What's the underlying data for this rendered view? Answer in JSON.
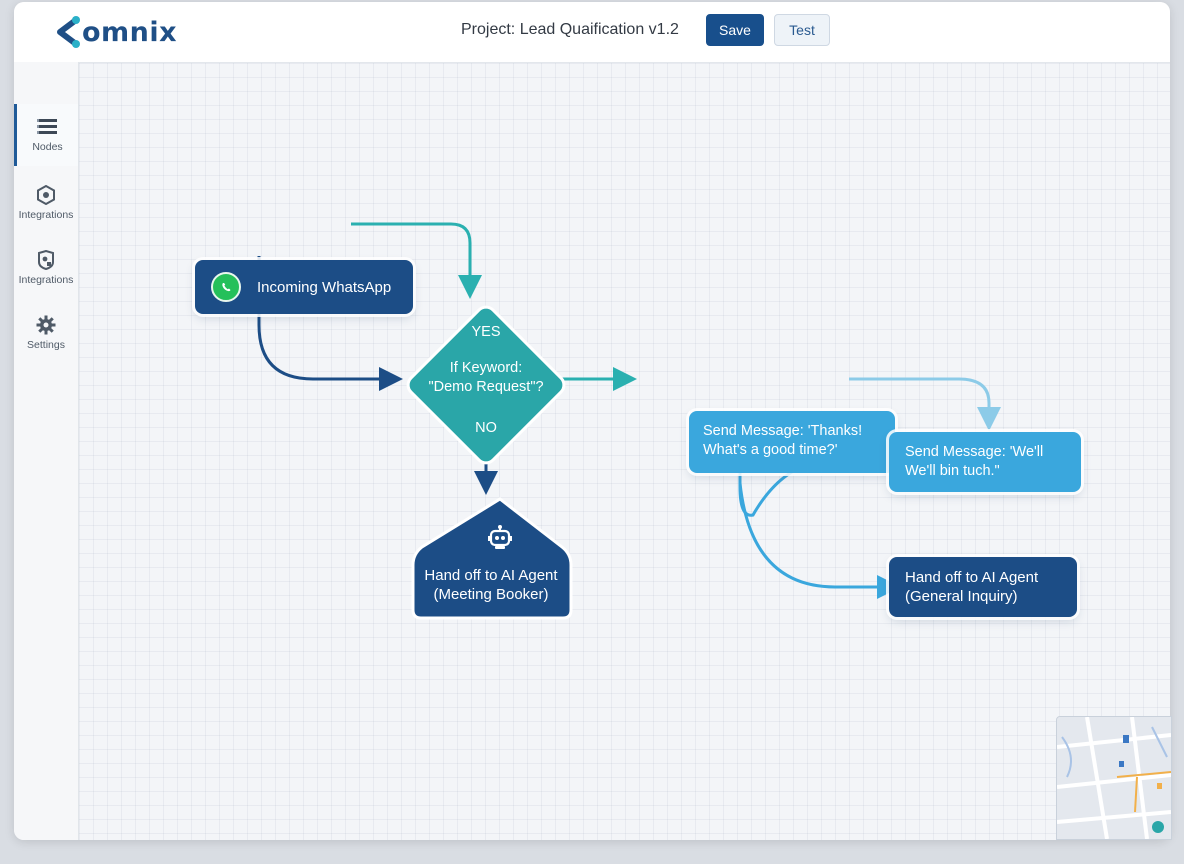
{
  "app": {
    "logo_text": "omnix",
    "project_title": "Project: Lead Quaification v1.2"
  },
  "toolbar": {
    "save_label": "Save",
    "test_label": "Test"
  },
  "sidebar": {
    "items": [
      {
        "label": "Nodes",
        "icon": "list-icon",
        "active": true
      },
      {
        "label": "Integrations",
        "icon": "hexagon-icon",
        "active": false
      },
      {
        "label": "Integrations",
        "icon": "shield-icon",
        "active": false
      },
      {
        "label": "Settings",
        "icon": "gear-icon",
        "active": false
      }
    ]
  },
  "flow": {
    "trigger": {
      "label": "Incoming WhatsApp",
      "icon": "whatsapp-icon"
    },
    "condition": {
      "yes": "YES",
      "line1": "If Keyword:",
      "line2": "\"Demo Request\"?",
      "no": "NO"
    },
    "agent_meeting": {
      "line1": "Hand off to AI Agent",
      "line2": "(Meeting Booker)",
      "icon": "robot-icon"
    },
    "message_thanks": {
      "line1": "Send Message: 'Thanks!",
      "line2": "What's a good time?'"
    },
    "message_touch": {
      "line1": "Send Message: 'We'll",
      "line2": "We'll bin tuch.\""
    },
    "agent_general": {
      "line1": "Hand off to AI Agent",
      "line2": "(General Inquiry)"
    }
  },
  "colors": {
    "primary_dark": "#1c4d86",
    "teal": "#2ab0b0",
    "light_blue": "#3aa7dd",
    "whatsapp_green": "#25c05a"
  }
}
